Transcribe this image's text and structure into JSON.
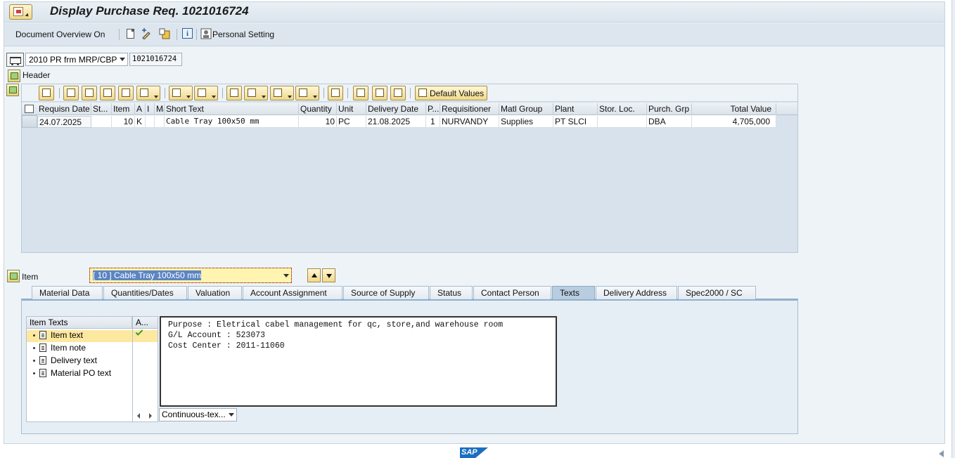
{
  "window": {
    "title": "Display Purchase Req. 1021016724"
  },
  "toolbar": {
    "document_overview": "Document Overview On",
    "personal_setting": "Personal Setting"
  },
  "doc_header": {
    "doc_type": "2010 PR frm MRP/CBP",
    "doc_number": "1021016724",
    "header_label": "Header"
  },
  "grid": {
    "default_values_label": "Default Values",
    "columns": [
      "Requisn Date",
      "St...",
      "Item",
      "A",
      "I",
      "Ma",
      "Short Text",
      "Quantity",
      "Unit",
      "Delivery Date",
      "P...",
      "Requisitioner",
      "Matl Group",
      "Plant",
      "Stor. Loc.",
      "Purch. Grp",
      "Total Value"
    ],
    "rows": [
      {
        "requisn_date": "24.07.2025",
        "status": "",
        "item": "10",
        "a": "K",
        "i": "",
        "ma": "",
        "short_text": "Cable Tray 100x50 mm",
        "quantity": "10",
        "unit": "PC",
        "delivery_date": "21.08.2025",
        "p": "1",
        "requisitioner": "NURVANDY",
        "matl_group": "Supplies",
        "plant": "PT SLCI",
        "stor_loc": "",
        "purch_grp": "DBA",
        "total_value": "4,705,000"
      }
    ]
  },
  "item_detail": {
    "item_label": "Item",
    "selected_item": "[ 10 ] Cable Tray 100x50 mm"
  },
  "tabs": [
    {
      "label": "Material Data"
    },
    {
      "label": "Quantities/Dates"
    },
    {
      "label": "Valuation"
    },
    {
      "label": "Account Assignment"
    },
    {
      "label": "Source of Supply"
    },
    {
      "label": "Status"
    },
    {
      "label": "Contact Person"
    },
    {
      "label": "Texts"
    },
    {
      "label": "Delivery Address"
    },
    {
      "label": "Spec2000 / SC"
    }
  ],
  "texts": {
    "tree_header": "Item Texts",
    "tree_header2": "A...",
    "items": [
      "Item text",
      "Item note",
      "Delivery text",
      "Material PO text"
    ],
    "editor_lines": [
      "Purpose : Eletrical cabel management for qc, store,and warehouse room",
      "G/L Account : 523073",
      "Cost Center : 2011-11060"
    ],
    "format": "Continuous-tex..."
  },
  "colors": {
    "accent": "#fff4b0",
    "tab_active": "#b9cde0",
    "panel": "#e6eef5"
  },
  "footer": {
    "logo": "SAP"
  }
}
